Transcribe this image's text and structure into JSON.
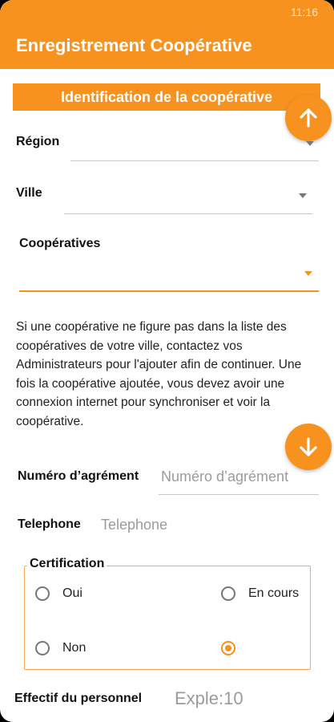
{
  "status_bar": {
    "time": "11:16"
  },
  "app_bar": {
    "title": "Enregistrement Coopérative"
  },
  "section": {
    "title": "Identification de la coopérative"
  },
  "fields": {
    "region_label": "Région",
    "ville_label": "Ville",
    "cooperatives_label": "Coopératives",
    "info_text": "Si une coopérative ne figure pas dans la liste des coopératives de votre ville, contactez vos Administrateurs pour l'ajouter afin de continuer. Une fois la coopérative ajoutée, vous devez avoir une connexion internet pour synchroniser et voir la coopérative.",
    "agrement_label": "Numéro d’agrément",
    "agrement_placeholder": "Numéro d’agrément",
    "telephone_label": "Telephone",
    "telephone_placeholder": "Telephone",
    "effectif_label": "Effectif du personnel",
    "effectif_placeholder": "Exple:10"
  },
  "certification": {
    "legend": "Certification",
    "options": [
      {
        "label": "Oui",
        "checked": false
      },
      {
        "label": "En cours",
        "checked": false
      },
      {
        "label": "Non",
        "checked": false
      },
      {
        "label": "",
        "checked": true
      }
    ]
  },
  "icons": {
    "scroll_up": "arrow-up-icon",
    "scroll_down": "arrow-down-icon",
    "dropdown": "triangle-down-icon"
  },
  "colors": {
    "accent": "#f7921e"
  }
}
